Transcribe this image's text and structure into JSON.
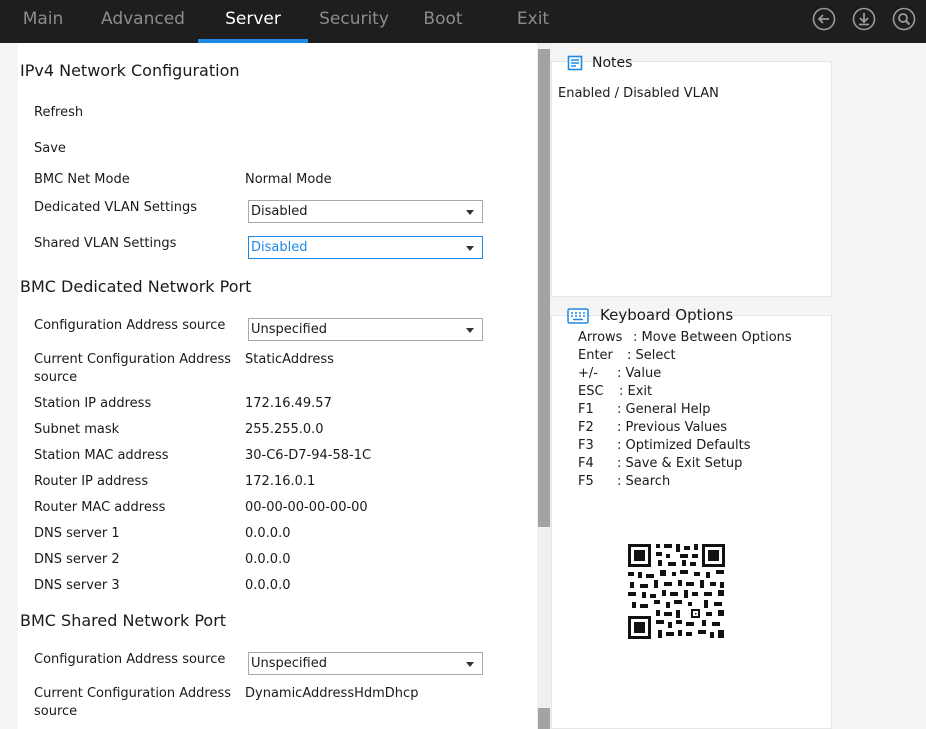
{
  "tabs": [
    {
      "label": "Main"
    },
    {
      "label": "Advanced"
    },
    {
      "label": "Server"
    },
    {
      "label": "Security"
    },
    {
      "label": "Boot"
    },
    {
      "label": "Exit"
    }
  ],
  "active_tab": "Server",
  "accent_color": "#1e88e5",
  "top_icons": [
    "back-arrow-icon",
    "download-icon",
    "search-icon"
  ],
  "sections": {
    "ipv4_title": "IPv4 Network Configuration",
    "dedicated_title": "BMC Dedicated Network Port",
    "shared_title": "BMC Shared Network Port"
  },
  "ipv4": {
    "refresh": "Refresh",
    "save": "Save",
    "net_mode_label": "BMC Net Mode",
    "net_mode_value": "Normal Mode",
    "dedicated_vlan_label": "Dedicated VLAN Settings",
    "dedicated_vlan_value": "Disabled",
    "shared_vlan_label": "Shared VLAN Settings",
    "shared_vlan_value": "Disabled"
  },
  "dedicated": {
    "config_source_label": "Configuration Address source",
    "config_source_value": "Unspecified",
    "current_source_label": "Current Configuration Address source",
    "current_source_value": "StaticAddress",
    "station_ip_label": "Station IP address",
    "station_ip_value": "172.16.49.57",
    "subnet_label": "Subnet mask",
    "subnet_value": "255.255.0.0",
    "station_mac_label": "Station MAC address",
    "station_mac_value": "30-C6-D7-94-58-1C",
    "router_ip_label": "Router IP address",
    "router_ip_value": "172.16.0.1",
    "router_mac_label": "Router MAC address",
    "router_mac_value": "00-00-00-00-00-00",
    "dns1_label": "DNS server 1",
    "dns1_value": "0.0.0.0",
    "dns2_label": "DNS server 2",
    "dns2_value": "0.0.0.0",
    "dns3_label": "DNS server 3",
    "dns3_value": "0.0.0.0"
  },
  "shared": {
    "config_source_label": "Configuration Address source",
    "config_source_value": "Unspecified",
    "current_source_label": "Current Configuration Address source",
    "current_source_value": "DynamicAddressHdmDhcp"
  },
  "notes": {
    "title": "Notes",
    "text": "Enabled / Disabled VLAN"
  },
  "keyboard": {
    "title": "Keyboard Options",
    "rows": [
      {
        "key": "Arrows",
        "desc": "Move Between Options"
      },
      {
        "key": "Enter",
        "desc": "Select"
      },
      {
        "key": "+/-",
        "desc": "Value"
      },
      {
        "key": "ESC",
        "desc": "Exit"
      },
      {
        "key": "F1",
        "desc": "General Help"
      },
      {
        "key": "F2",
        "desc": "Previous Values"
      },
      {
        "key": "F3",
        "desc": "Optimized Defaults"
      },
      {
        "key": "F4",
        "desc": "Save & Exit Setup"
      },
      {
        "key": "F5",
        "desc": "Search"
      }
    ]
  }
}
